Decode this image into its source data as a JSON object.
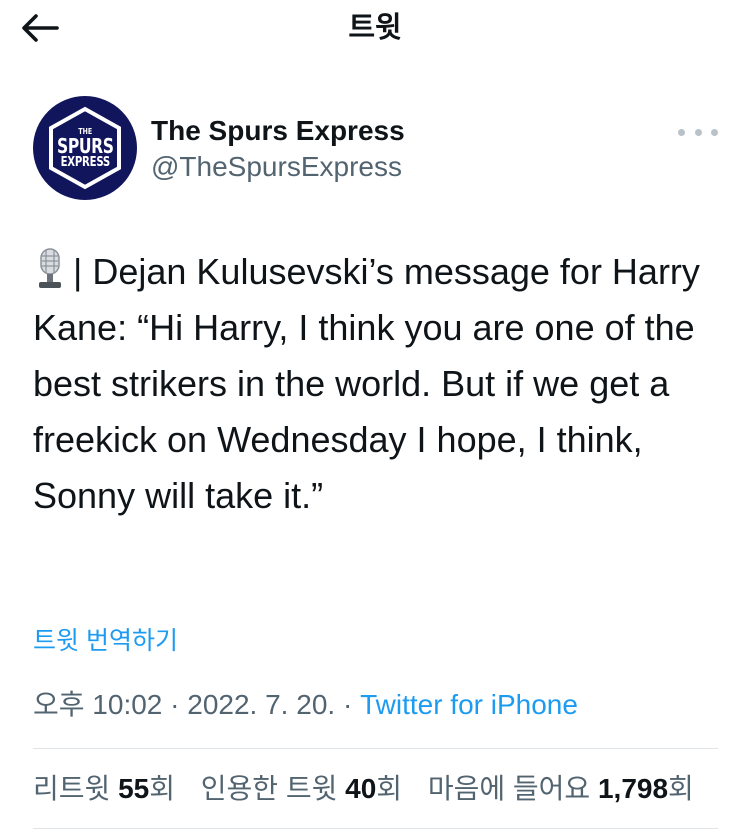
{
  "header": {
    "title": "트윗"
  },
  "author": {
    "name": "The Spurs Express",
    "handle": "@TheSpursExpress",
    "avatar_lines": [
      "THE",
      "SPURS",
      "EXPRESS"
    ]
  },
  "tweet": {
    "prefix": "| Dejan Kulusevski’s message for Harry Kane: “Hi Harry, I think you are one of the best strikers in the world. But if we get a freekick on Wednesday I hope, I think, Sonny will take it.”",
    "emoji_icon": "microphone-icon",
    "translate_label": "트윗 번역하기",
    "time": "오후 10:02",
    "date": "2022. 7. 20.",
    "separator": "·",
    "source": "Twitter for iPhone"
  },
  "stats": {
    "retweets_label": "리트윗",
    "retweets_count": "55",
    "retweets_unit": "회",
    "quotes_label": "인용한 트윗",
    "quotes_count": "40",
    "quotes_unit": "회",
    "likes_label": "마음에 들어요",
    "likes_count": "1,798",
    "likes_unit": "회"
  },
  "colors": {
    "accent": "#1d9bf0",
    "avatar_bg": "#11155c",
    "secondary_text": "#536471"
  }
}
